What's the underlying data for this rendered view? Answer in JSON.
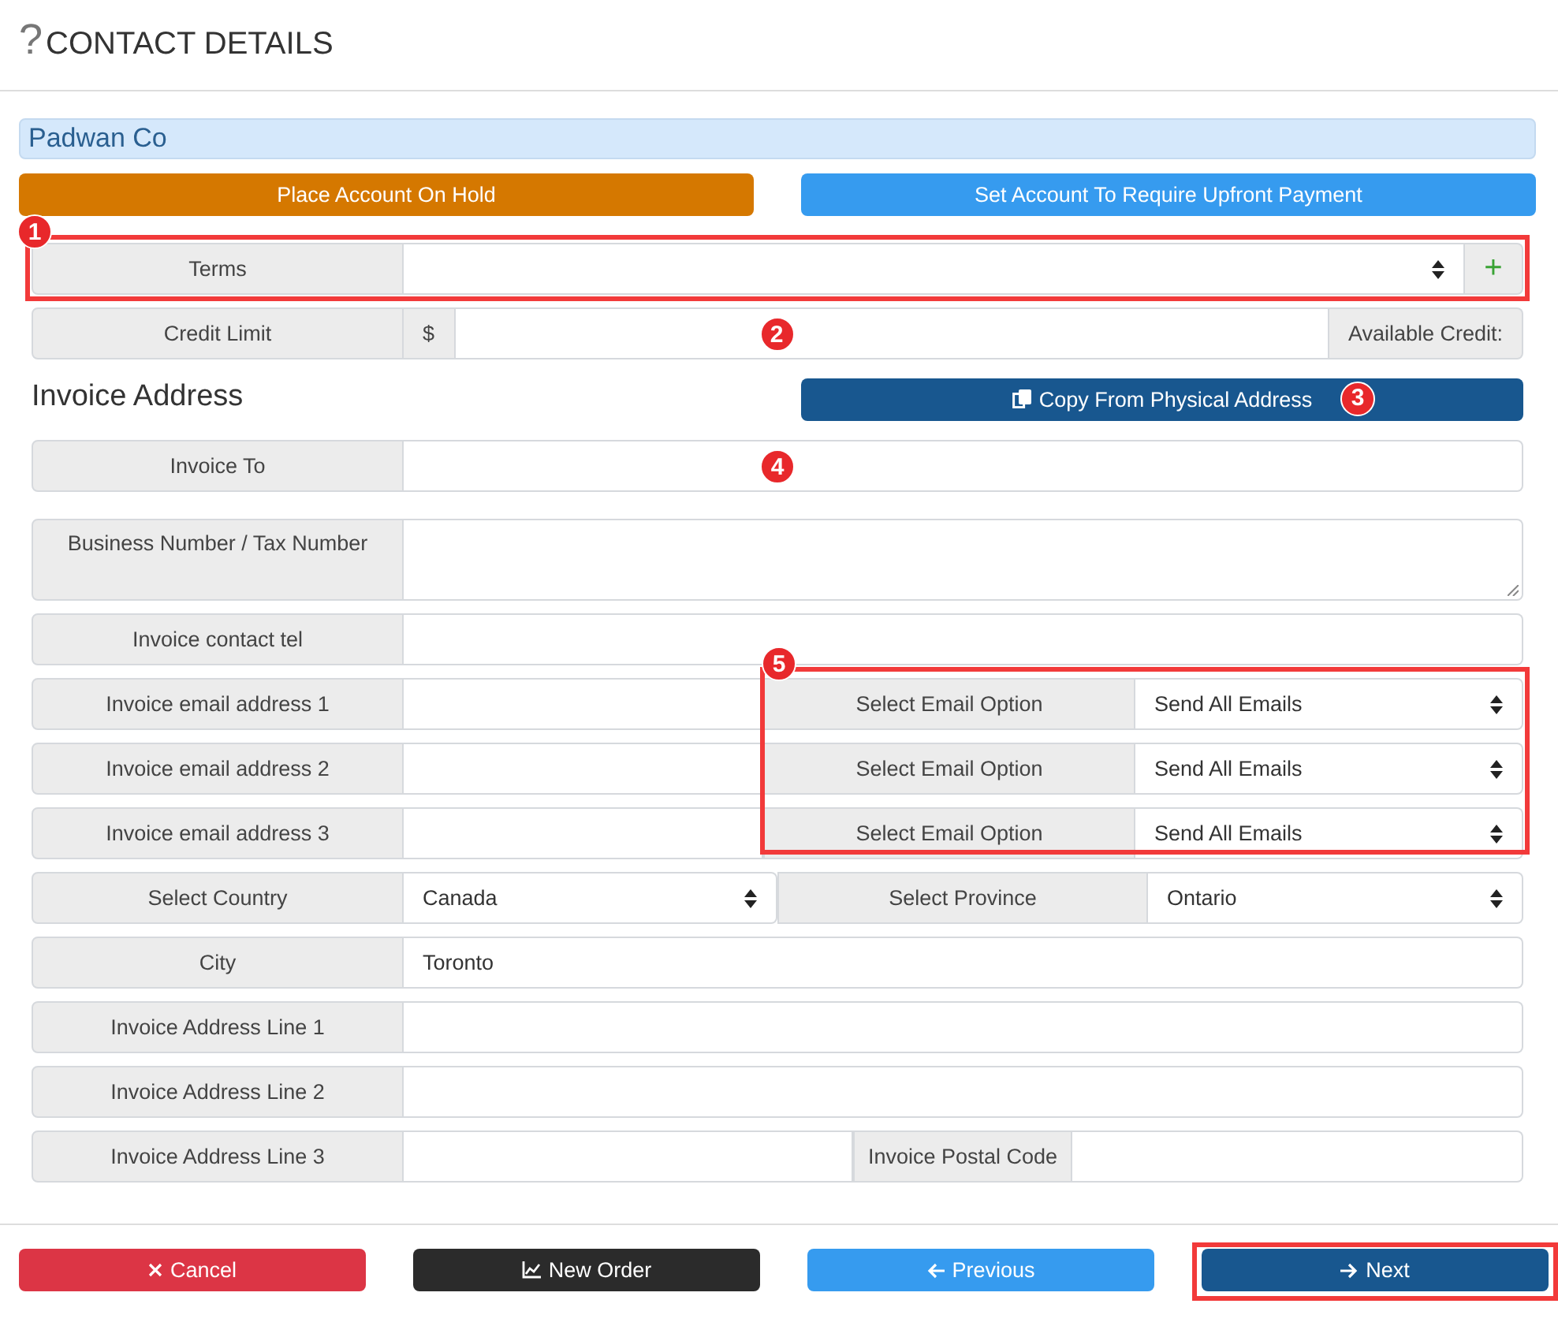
{
  "header": {
    "help": "?",
    "title": "CONTACT DETAILS"
  },
  "company": {
    "name": "Padwan Co"
  },
  "account_actions": [
    {
      "label": "Place Account On Hold",
      "kind": "warning"
    },
    {
      "label": "Set Account To Require Upfront Payment",
      "kind": "info"
    }
  ],
  "terms": {
    "label": "Terms",
    "add": "+",
    "highlighted": true,
    "badge": "1"
  },
  "credit": {
    "label": "Credit Limit",
    "prefix": "$",
    "suffix": "Available Credit:",
    "badge": "2"
  },
  "invoice_address": {
    "heading": "Invoice Address",
    "copy_button": "Copy From Physical Address",
    "copy_badge": "3"
  },
  "fields": [
    {
      "kind": "text",
      "label": "Invoice To",
      "badge": "4"
    },
    {
      "kind": "textarea",
      "label": "Business Number / Tax Number"
    },
    {
      "kind": "text",
      "label": "Invoice contact tel"
    },
    {
      "kind": "email_group",
      "highlighted": true,
      "badge": "5",
      "rows": [
        {
          "label": "Invoice email address 1",
          "option_label": "Select Email Option",
          "option": "Send All Emails"
        },
        {
          "label": "Invoice email address 2",
          "option_label": "Select Email Option",
          "option": "Send All Emails"
        },
        {
          "label": "Invoice email address 3",
          "option_label": "Select Email Option",
          "option": "Send All Emails"
        }
      ]
    },
    {
      "kind": "select_pair",
      "label": "Select Country",
      "value": "Canada",
      "label2": "Select Province",
      "value2": "Ontario"
    },
    {
      "kind": "text",
      "label": "City",
      "value": "Toronto"
    },
    {
      "kind": "text",
      "label": "Invoice Address Line 1"
    },
    {
      "kind": "text",
      "label": "Invoice Address Line 2"
    },
    {
      "kind": "text_pair",
      "label": "Invoice Address Line 3",
      "label2": "Invoice Postal Code"
    }
  ],
  "footer_buttons": [
    {
      "label": "Cancel",
      "kind": "danger",
      "highlighted": false
    },
    {
      "label": "New Order",
      "kind": "dark",
      "highlighted": false
    },
    {
      "label": "Previous",
      "kind": "info",
      "highlighted": false
    },
    {
      "label": "Next",
      "kind": "primary",
      "highlighted": true
    }
  ]
}
